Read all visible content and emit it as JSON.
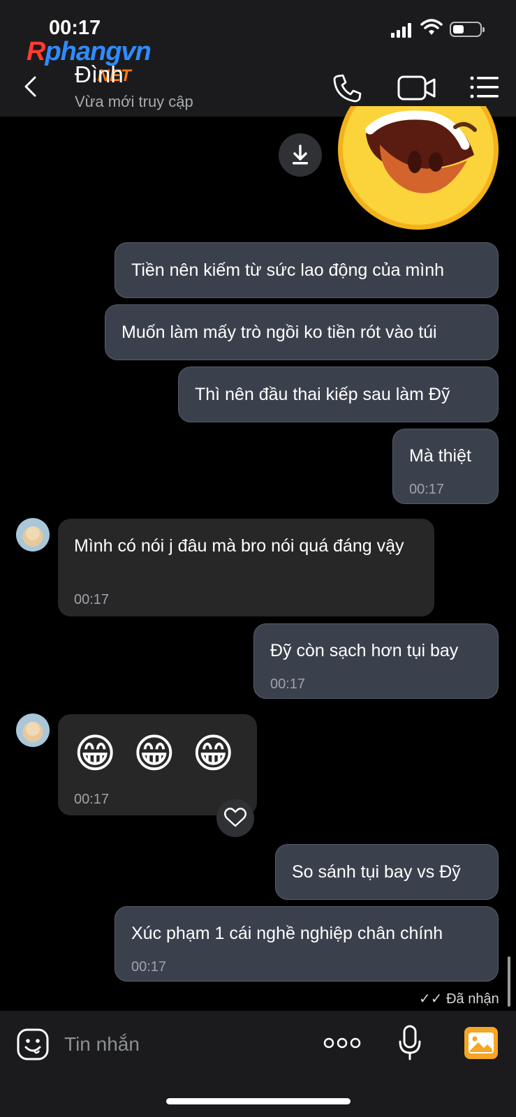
{
  "status_bar": {
    "time": "00:17"
  },
  "watermark": {
    "line1a": "R",
    "line1b": "phangvn",
    "line2": ".NET"
  },
  "header": {
    "contact_name": "Đình",
    "contact_status": "Vừa mới truy cập"
  },
  "messages": [
    {
      "side": "out",
      "text": "Tiền nên kiếm từ sức lao động của mình"
    },
    {
      "side": "out",
      "text": "Muốn làm mấy trò ngồi ko tiền rót vào túi"
    },
    {
      "side": "out",
      "text": "Thì nên đầu thai kiếp sau làm Đỹ"
    },
    {
      "side": "out",
      "text": "Mà thiệt",
      "time": "00:17"
    },
    {
      "side": "in",
      "text": "Mình có nói j đâu mà bro nói quá đáng vậy",
      "time": "00:17"
    },
    {
      "side": "out",
      "text": "Đỹ còn sạch hơn tụi bay",
      "time": "00:17"
    },
    {
      "side": "in",
      "text": "😁 😁 😁",
      "time": "00:17"
    },
    {
      "side": "out",
      "text": "So sánh tụi bay vs Đỹ"
    },
    {
      "side": "out",
      "text": "Xúc phạm 1 cái nghề nghiệp chân chính",
      "time": "00:17"
    }
  ],
  "delivery_status": "✓✓ Đã nhận",
  "composer": {
    "placeholder": "Tin nhắn"
  },
  "icons": {
    "back": "chevron-left-icon",
    "call": "phone-icon",
    "video": "video-camera-icon",
    "menu": "list-menu-icon",
    "download": "download-icon",
    "reaction": "heart-icon",
    "emoji": "emoji-icon",
    "more": "more-dots-icon",
    "mic": "microphone-icon",
    "image": "image-icon"
  },
  "colors": {
    "background": "#000000",
    "header": "#1b1b1d",
    "outgoing_bubble": "#3b414c",
    "incoming_bubble": "#272727",
    "image_button": "#f5a623"
  }
}
